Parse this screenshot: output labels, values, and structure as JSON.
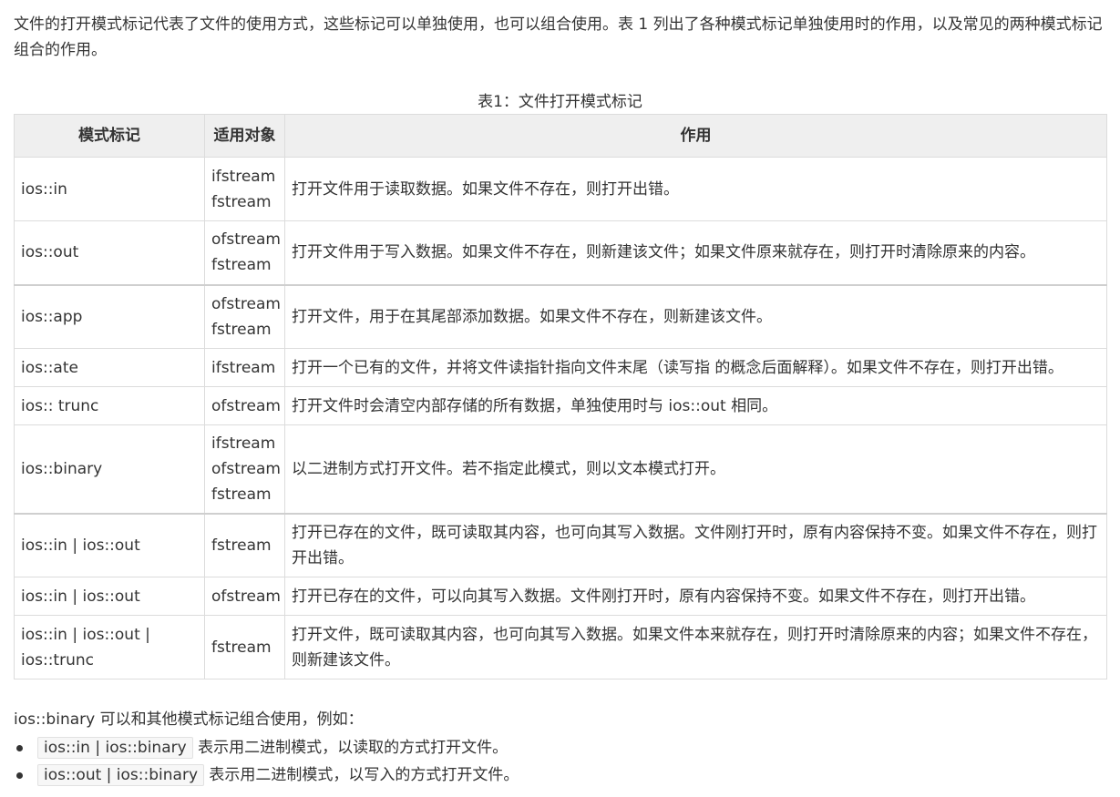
{
  "intro": "文件的打开模式标记代表了文件的使用方式，这些标记可以单独使用，也可以组合使用。表 1 列出了各种模式标记单独使用时的作用，以及常见的两种模式标记组合的作用。",
  "table": {
    "caption": "表1：文件打开模式标记",
    "headers": [
      "模式标记",
      "适用对象",
      "作用"
    ],
    "rows": [
      {
        "flag": "ios::in",
        "targets": [
          "ifstream",
          "fstream"
        ],
        "desc": "打开文件用于读取数据。如果文件不存在，则打开出错。"
      },
      {
        "flag": "ios::out",
        "targets": [
          "ofstream",
          "fstream"
        ],
        "desc": "打开文件用于写入数据。如果文件不存在，则新建该文件；如果文件原来就存在，则打开时清除原来的内容。"
      },
      {
        "flag": "ios::app",
        "targets": [
          "ofstream",
          "fstream"
        ],
        "desc": "打开文件，用于在其尾部添加数据。如果文件不存在，则新建该文件。"
      },
      {
        "flag": "ios::ate",
        "targets": [
          "ifstream"
        ],
        "desc": "打开一个已有的文件，并将文件读指针指向文件末尾（读写指 的概念后面解释）。如果文件不存在，则打开出错。"
      },
      {
        "flag": "ios:: trunc",
        "targets": [
          "ofstream"
        ],
        "desc": "打开文件时会清空内部存储的所有数据，单独使用时与 ios::out 相同。"
      },
      {
        "flag": "ios::binary",
        "targets": [
          "ifstream",
          "ofstream",
          "fstream"
        ],
        "desc": "以二进制方式打开文件。若不指定此模式，则以文本模式打开。"
      },
      {
        "flag": "ios::in | ios::out",
        "targets": [
          "fstream"
        ],
        "desc": "打开已存在的文件，既可读取其内容，也可向其写入数据。文件刚打开时，原有内容保持不变。如果文件不存在，则打开出错。"
      },
      {
        "flag": "ios::in | ios::out",
        "targets": [
          "ofstream"
        ],
        "desc": "打开已存在的文件，可以向其写入数据。文件刚打开时，原有内容保持不变。如果文件不存在，则打开出错。"
      },
      {
        "flag": "ios::in | ios::out | ios::trunc",
        "targets": [
          "fstream"
        ],
        "desc": "打开文件，既可读取其内容，也可向其写入数据。如果文件本来就存在，则打开时清除原来的内容；如果文件不存在，则新建该文件。"
      }
    ]
  },
  "outro": "ios::binary 可以和其他模式标记组合使用，例如：",
  "examples": [
    {
      "code": "ios::in | ios::binary",
      "text": "表示用二进制模式，以读取的方式打开文件。"
    },
    {
      "code": "ios::out | ios::binary",
      "text": "表示用二进制模式，以写入的方式打开文件。"
    }
  ]
}
